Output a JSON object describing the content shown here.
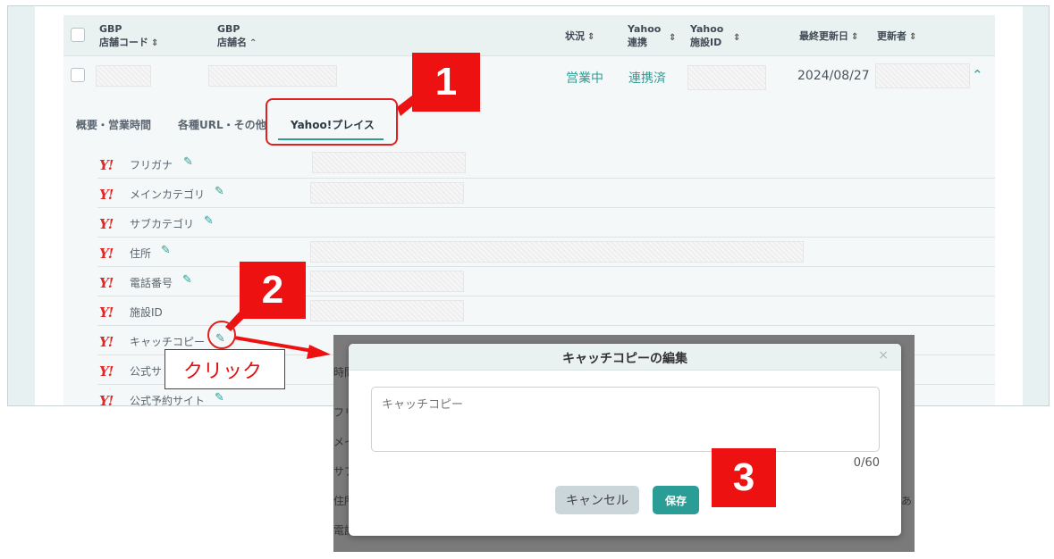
{
  "header": {
    "col_store_code": [
      "GBP",
      "店舗コード"
    ],
    "col_store_name": [
      "GBP",
      "店舗名"
    ],
    "col_status": "状況",
    "col_yahoo_link": [
      "Yahoo",
      "連携"
    ],
    "col_yahoo_facility": [
      "Yahoo",
      "施設ID"
    ],
    "col_updated": "最終更新日",
    "col_updater": "更新者"
  },
  "row": {
    "status": "営業中",
    "link": "連携済",
    "updated": "2024/08/27"
  },
  "tabs": [
    "概要・営業時間",
    "各種URL・その他",
    "Yahoo!プレイス"
  ],
  "yahoo_logo": "Y!",
  "fields": [
    "フリガナ",
    "メインカテゴリ",
    "サブカテゴリ",
    "住所",
    "電話番号",
    "施設ID",
    "キャッチコピー",
    "公式サ",
    "公式予約サイト"
  ],
  "callouts": {
    "one": "1",
    "two": "2",
    "three": "3",
    "click": "クリック"
  },
  "ghost_texts": {
    "g1": "時間",
    "g2": "フリ",
    "g3": "メイ",
    "g4": "サブ",
    "g5": "住所",
    "g6": "電話",
    "g7": "あ"
  },
  "modal": {
    "title": "キャッチコピーの編集",
    "close": "×",
    "placeholder": "キャッチコピー",
    "counter": "0/60",
    "cancel": "キャンセル",
    "save": "保存"
  },
  "colors": {
    "accent": "#2a9d96",
    "callout": "#ee1111",
    "yahoo": "#e02828"
  }
}
